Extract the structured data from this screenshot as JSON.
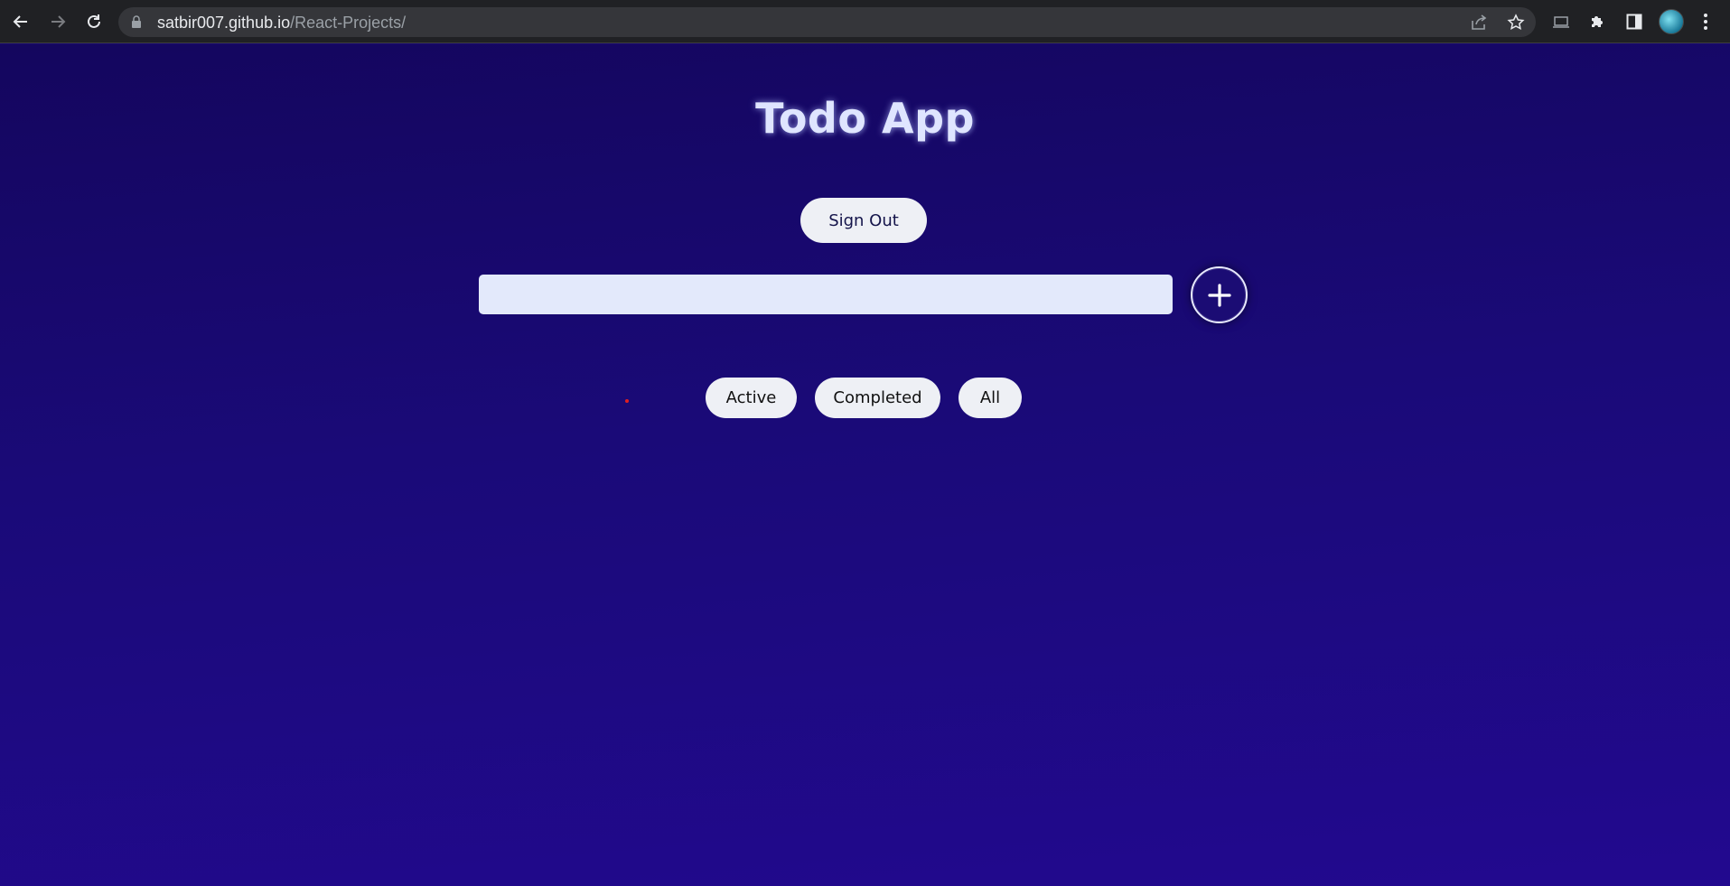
{
  "browser": {
    "url_host": "satbir007.github.io",
    "url_path": "/React-Projects/"
  },
  "app": {
    "title": "Todo App",
    "signout_label": "Sign Out",
    "input_placeholder": "",
    "add_label": "+",
    "filters": {
      "active": "Active",
      "completed": "Completed",
      "all": "All"
    }
  },
  "colors": {
    "background_top": "#14065e",
    "background_bottom": "#22098f",
    "input_bg": "#e3e9fb",
    "button_bg": "#eef0f5"
  }
}
